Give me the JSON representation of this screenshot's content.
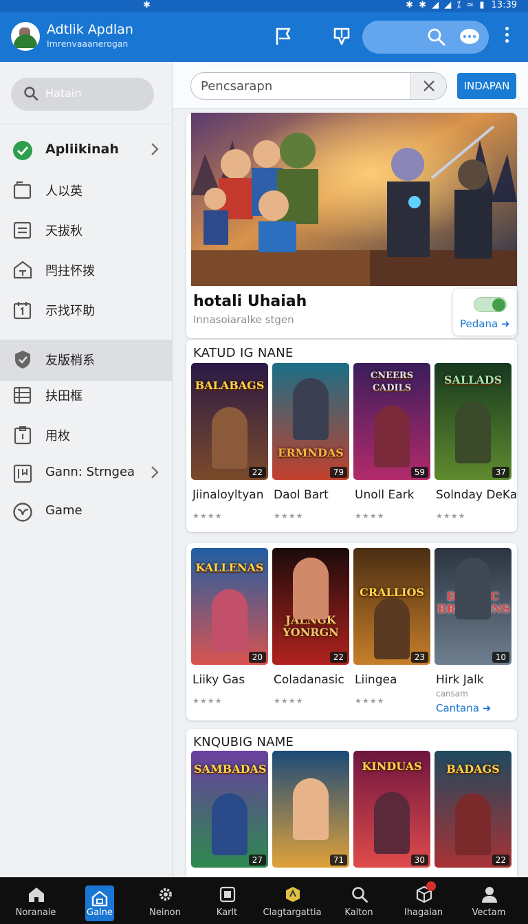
{
  "status_bar": {
    "center_icon": "bluetooth-icon",
    "right_icons": "✱ ✱ ◢ ◢ ⁒ ≈ ▮",
    "time": "13:39"
  },
  "app_bar": {
    "title": "Adtlik Apdlan",
    "subtitle": "Imrenvaaanerogan",
    "icons": [
      "flag-icon",
      "bookmark-icon",
      "search-icon",
      "chat-icon",
      "more-icon"
    ]
  },
  "sidebar": {
    "search_placeholder": "Hatain",
    "items": [
      {
        "label": "Apliikinah",
        "icon": "check-circle-icon",
        "has_chevron": true,
        "active": false
      },
      {
        "label": "人以英",
        "icon": "folder-icon",
        "has_chevron": false,
        "active": false
      },
      {
        "label": "天拔秋",
        "icon": "list-icon",
        "has_chevron": false,
        "active": false
      },
      {
        "label": "閂拄怀拨",
        "icon": "home-icon",
        "has_chevron": false,
        "active": false
      },
      {
        "label": "示找环助",
        "icon": "calendar-icon",
        "has_chevron": false,
        "active": false
      },
      {
        "label": "友版梢系",
        "icon": "shield-icon",
        "has_chevron": false,
        "active": true
      },
      {
        "label": "扶田框",
        "icon": "table-icon",
        "has_chevron": false,
        "active": false
      },
      {
        "label": "用枚",
        "icon": "clipboard-icon",
        "has_chevron": false,
        "active": false
      },
      {
        "label": "Gann: Strngea",
        "icon": "bookmark-box-icon",
        "has_chevron": true,
        "active": false
      },
      {
        "label": "Game",
        "icon": "globe-icon",
        "has_chevron": false,
        "active": false
      }
    ]
  },
  "search": {
    "placeholder": "Pencsarapn",
    "button_label": "INDAPAN"
  },
  "featured": {
    "title": "hotali Uhaiah",
    "subtitle": "Innasoiaralke stgen",
    "toggle_on": true,
    "link_label": "Pedana ➜"
  },
  "sections": [
    {
      "title": "KATUD IG NANE",
      "games": [
        {
          "cover_title": "BALABAGS",
          "name": "Jiinaloyltyan",
          "badge": "22",
          "stars": "★★★★",
          "colors": [
            "#2a1a46",
            "#7b4a2a"
          ]
        },
        {
          "cover_title": "ERMNDAS",
          "name": "Daol Bart",
          "badge": "79",
          "stars": "★★★★",
          "colors": [
            "#1b6f86",
            "#c2402d"
          ]
        },
        {
          "cover_title": "CNEERS CADILS",
          "name": "Unoll Eark",
          "badge": "59",
          "stars": "★★★★",
          "colors": [
            "#3b1d5c",
            "#b22a6a"
          ]
        },
        {
          "cover_title": "SALLADS",
          "name": "Solnday DeKay",
          "badge": "37",
          "stars": "★★★★",
          "colors": [
            "#17381f",
            "#5f8b2e"
          ]
        }
      ]
    },
    {
      "title": "",
      "games": [
        {
          "cover_title": "KALLENAS",
          "name": "Liiky Gas",
          "badge": "20",
          "stars": "★★★★",
          "colors": [
            "#1f5fa3",
            "#d9534f"
          ]
        },
        {
          "cover_title": "JALNGK YONRGN",
          "name": "Coladanasic",
          "badge": "22",
          "stars": "★★★★",
          "colors": [
            "#1b0b0b",
            "#b1221f"
          ]
        },
        {
          "cover_title": "CRALLIOS",
          "name": "Liingea",
          "badge": "23",
          "stars": "★★★★",
          "colors": [
            "#4a2d12",
            "#c77f2a"
          ]
        },
        {
          "cover_title": "DRINOC BROSKONS",
          "name": "Hirk Jalk",
          "badge": "10",
          "stars": "",
          "extra": "cansam",
          "link": "Cantana ➜",
          "colors": [
            "#2b3440",
            "#6f7f8f"
          ]
        }
      ]
    },
    {
      "title": "KNQUBIG NAME",
      "games": [
        {
          "cover_title": "SAMBADAS",
          "name": "",
          "badge": "27",
          "stars": "",
          "colors": [
            "#6a3fa0",
            "#2d8a4e"
          ]
        },
        {
          "cover_title": "",
          "name": "",
          "badge": "71",
          "stars": "",
          "colors": [
            "#1c4a78",
            "#e0a23a"
          ]
        },
        {
          "cover_title": "KINDUAS",
          "name": "",
          "badge": "30",
          "stars": "",
          "colors": [
            "#6e1540",
            "#e04b4b"
          ]
        },
        {
          "cover_title": "BADAGS",
          "name": "",
          "badge": "22",
          "stars": "",
          "colors": [
            "#1f4a5e",
            "#a83236"
          ]
        }
      ]
    }
  ],
  "bottom_nav": [
    {
      "label": "Noranaie",
      "icon": "home-icon"
    },
    {
      "label": "Galne",
      "icon": "store-icon",
      "active": true
    },
    {
      "label": "Neinon",
      "icon": "gear-icon"
    },
    {
      "label": "Karlt",
      "icon": "box-icon"
    },
    {
      "label": "Clagtargattia",
      "icon": "badge-icon"
    },
    {
      "label": "Kalton",
      "icon": "search-icon"
    },
    {
      "label": "Ihagaian",
      "icon": "cube-icon",
      "notification": true
    },
    {
      "label": "Vectam",
      "icon": "user-icon"
    }
  ],
  "colors": {
    "primary": "#1976d2",
    "link": "#1976d2",
    "toggle_on": "#43a047",
    "notification": "#d32f2f"
  }
}
